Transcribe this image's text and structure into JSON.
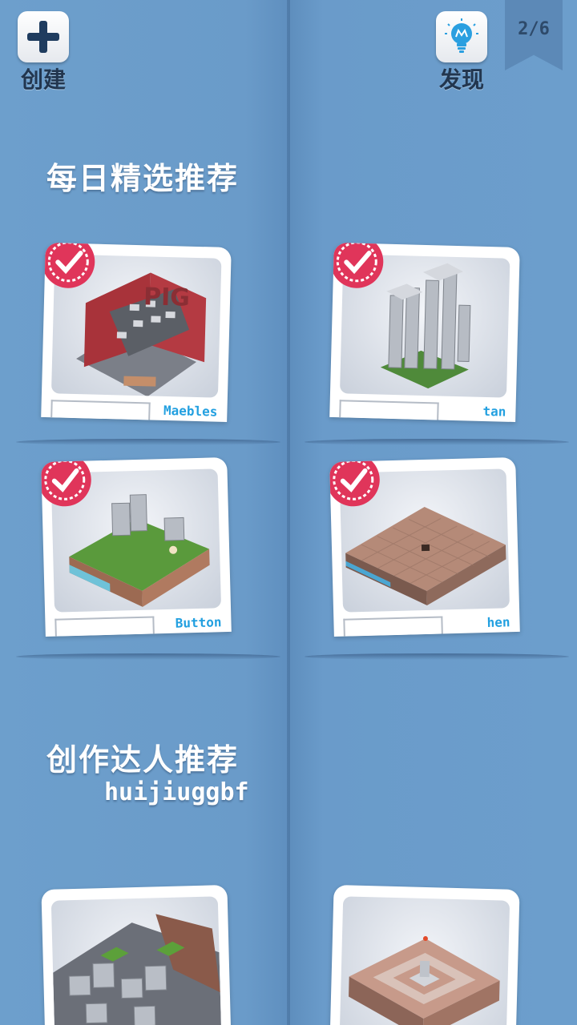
{
  "header": {
    "create_label": "创建",
    "discover_label": "发现",
    "page_indicator": "2/6"
  },
  "sections": {
    "daily_title": "每日精选推荐",
    "creator_title": "创作达人推荐",
    "creator_name": "huijiuggbf"
  },
  "daily_levels": [
    {
      "author": "Maebles",
      "selected": true,
      "scene": "pig-brick-machine"
    },
    {
      "author": "tan",
      "selected": true,
      "scene": "stone-towers"
    },
    {
      "author": "Button",
      "selected": true,
      "scene": "grass-island"
    },
    {
      "author": "hen",
      "selected": true,
      "scene": "brick-plaza"
    }
  ],
  "creator_levels": [
    {
      "scene": "stone-fortress"
    },
    {
      "scene": "brick-maze"
    }
  ],
  "colors": {
    "background": "#6a9ccb",
    "badge": "#e0355a",
    "author_text": "#23a0e0",
    "label_text": "#22364f"
  }
}
